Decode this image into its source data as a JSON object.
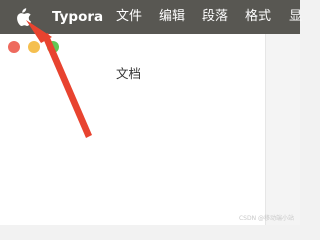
{
  "menubar": {
    "app_name": "Typora",
    "items": [
      "文件",
      "编辑",
      "段落",
      "格式",
      "显"
    ]
  },
  "window": {
    "title": "文档"
  },
  "watermark": "CSDN @移动端小站",
  "annotation": {
    "arrow_color": "#e8432f",
    "points_to": "apple-icon"
  },
  "icons": [
    "apple-icon"
  ]
}
